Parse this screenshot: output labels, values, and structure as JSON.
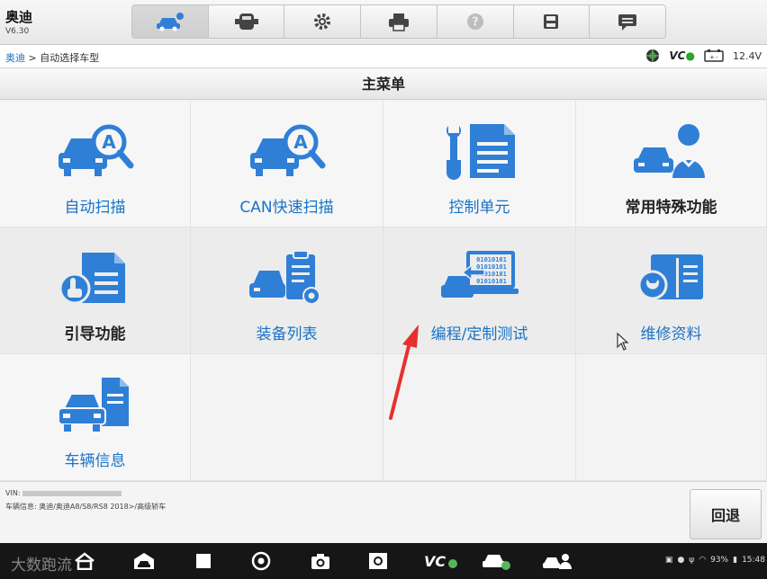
{
  "app": {
    "title": "奥迪",
    "version": "V6.30"
  },
  "breadcrumb": {
    "link": "奥迪",
    "separator": " > ",
    "current": "自动选择车型"
  },
  "status": {
    "vci_label": "VC",
    "battery": "12.4V"
  },
  "menu": {
    "title": "主菜单",
    "items": [
      {
        "label": "自动扫描",
        "icon": "car-scan-icon"
      },
      {
        "label": "CAN快速扫描",
        "icon": "can-quick-scan-icon"
      },
      {
        "label": "控制单元",
        "icon": "control-unit-icon"
      },
      {
        "label": "常用特殊功能",
        "icon": "special-function-icon"
      },
      {
        "label": "引导功能",
        "icon": "guided-function-icon"
      },
      {
        "label": "装备列表",
        "icon": "equipment-list-icon"
      },
      {
        "label": "编程/定制测试",
        "icon": "programming-icon"
      },
      {
        "label": "维修资料",
        "icon": "repair-info-icon"
      },
      {
        "label": "车辆信息",
        "icon": "vehicle-info-icon"
      }
    ]
  },
  "footer": {
    "vin_label": "VIN:",
    "vehicle_info": "车辆信息: 奥迪/奥迪A8/S8/RS8 2018>/高级轿车",
    "back_label": "回退"
  },
  "navbar": {
    "watermark": "大数跑流",
    "battery": "93%",
    "time": "15:48"
  },
  "colors": {
    "accent": "#1a73c7",
    "icon_blue": "#2f7fd6"
  }
}
